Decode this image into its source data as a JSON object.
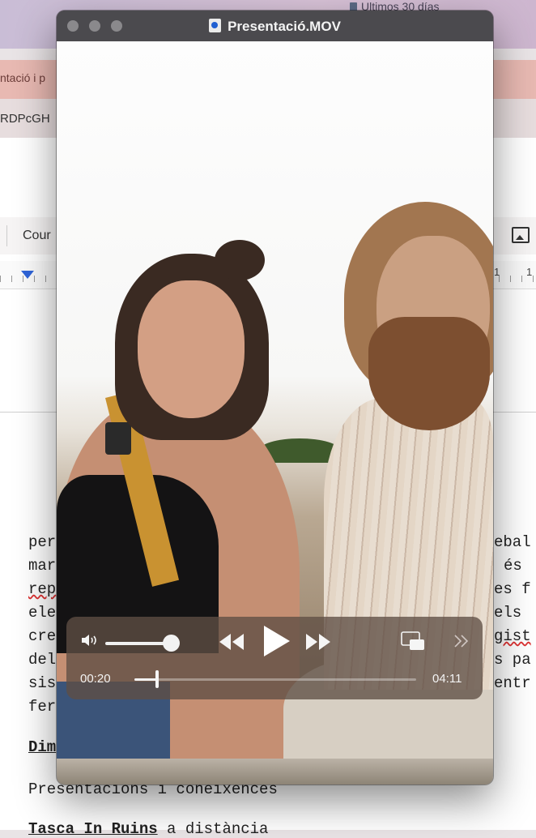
{
  "background": {
    "menu_text": "Ultimos 30 días",
    "tab_title": "ntació i p",
    "url_fragment": "RDPcGH",
    "toolbar_font": "Cour",
    "ruler_numbers": [
      "1",
      "1"
    ],
    "doc_lines": [
      {
        "left": "per",
        "right": "ebal"
      },
      {
        "left": "mar",
        "right": "és"
      },
      {
        "left": "rep",
        "right": "es f"
      },
      {
        "left": "ele",
        "right": "els"
      },
      {
        "left": "cre",
        "right": "gist"
      },
      {
        "left": "del",
        "right": "s pa"
      },
      {
        "left": "sis",
        "right": "entr"
      },
      {
        "left": "fer",
        "right": ""
      }
    ],
    "heading_dim": "Dim",
    "presentacions": "Presentacions i coneixences",
    "tasca_bold": "Tasca In Ruins",
    "tasca_rest": " a distància"
  },
  "player": {
    "window_title": "Presentació.MOV",
    "current_time": "00:20",
    "total_time": "04:11",
    "progress_fraction": 0.08,
    "volume_fraction": 0.85,
    "icons": [
      "volume-icon",
      "rewind-icon",
      "play-icon",
      "fast-forward-icon",
      "picture-in-picture-icon",
      "more-icon"
    ]
  }
}
